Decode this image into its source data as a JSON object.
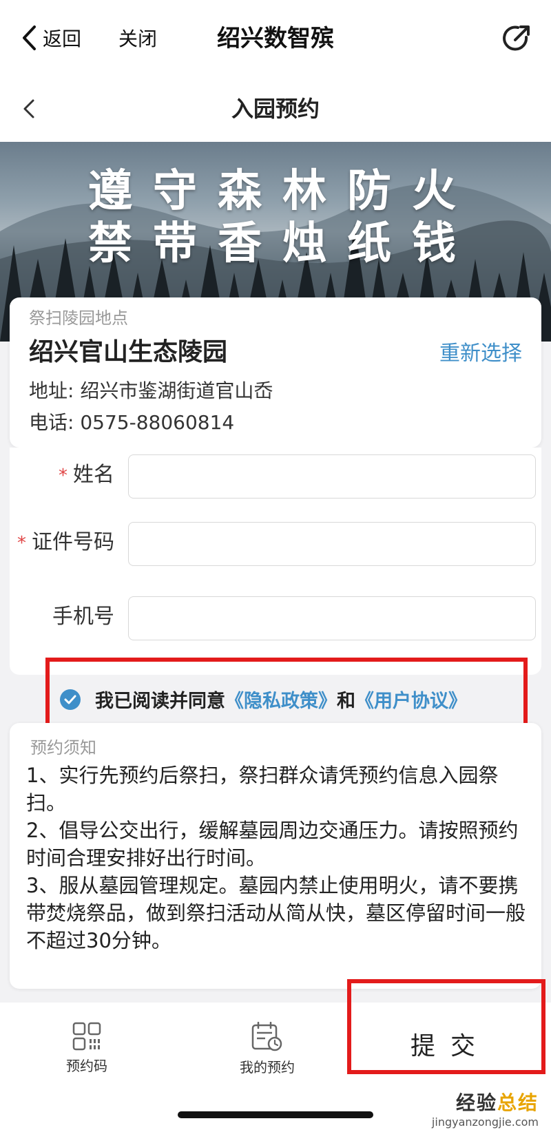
{
  "topbar": {
    "back_label": "返回",
    "close_label": "关闭",
    "title": "绍兴数智殡"
  },
  "subbar": {
    "title": "入园预约"
  },
  "banner": {
    "line1": "遵守森林防火",
    "line2": "禁带香烛纸钱"
  },
  "location": {
    "label": "祭扫陵园地点",
    "name": "绍兴官山生态陵园",
    "reselect": "重新选择",
    "address": "地址: 绍兴市鉴湖街道官山岙",
    "phone": "电话: 0575-88060814"
  },
  "form": {
    "required_mark": "*",
    "name_label": "姓名",
    "name_value": "",
    "id_label": "证件号码",
    "id_value": "",
    "phone_label": "手机号",
    "phone_value": ""
  },
  "agreement": {
    "checked": true,
    "prefix": "我已阅读并同意",
    "privacy": "《隐私政策》",
    "and": "和",
    "terms": "《用户协议》"
  },
  "notice": {
    "title": "预约须知",
    "items": [
      "1、实行先预约后祭扫，祭扫群众请凭预约信息入园祭扫。",
      "2、倡导公交出行，缓解墓园周边交通压力。请按照预约时间合理安排好出行时间。",
      "3、服从墓园管理规定。墓园内禁止使用明火，请不要携带焚烧祭品，做到祭扫活动从简从快，墓区停留时间一般不超过30分钟。"
    ]
  },
  "tabbar": {
    "tab1": "预约码",
    "tab2": "我的预约",
    "submit": "提交"
  },
  "watermark": {
    "line1_a": "经验",
    "line1_b": "总结",
    "line2": "jingyanzongjie.com"
  },
  "colors": {
    "accent": "#3f8fc9",
    "required": "#e04545",
    "highlight_box": "#e31b1b"
  }
}
